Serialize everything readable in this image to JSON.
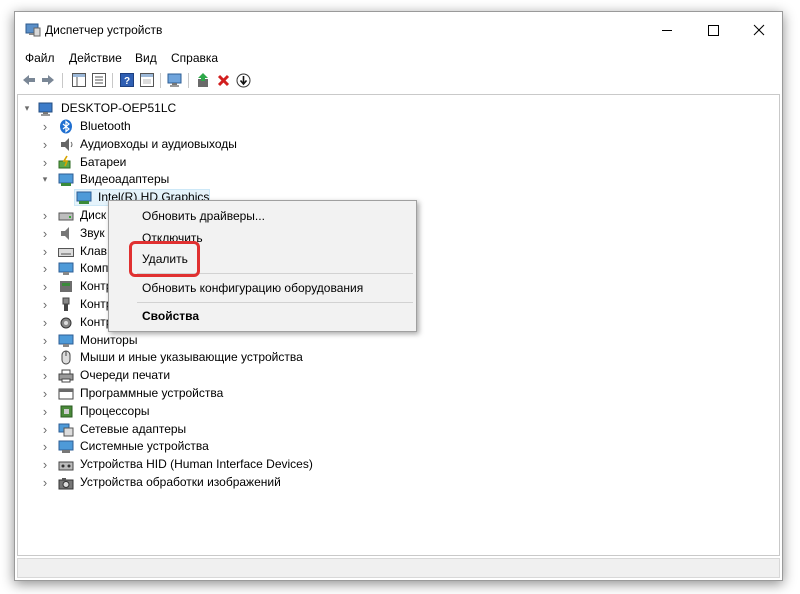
{
  "window": {
    "title": "Диспетчер устройств"
  },
  "menu": [
    "Файл",
    "Действие",
    "Вид",
    "Справка"
  ],
  "tree": {
    "root": "DESKTOP-OEP51LC",
    "items": [
      {
        "label": "Bluetooth",
        "icon": "bluetooth-icon"
      },
      {
        "label": "Аудиовходы и аудиовыходы",
        "icon": "speaker-icon"
      },
      {
        "label": "Батареи",
        "icon": "battery-icon"
      },
      {
        "label": "Видеоадаптеры",
        "icon": "display-adapter-icon",
        "expanded": true
      },
      {
        "label": "Intel(R) HD Graphics",
        "icon": "display-adapter-icon",
        "child": true,
        "selected": true
      },
      {
        "label": "Диск",
        "icon": "disk-drive-icon"
      },
      {
        "label": "Звук",
        "icon": "sound-icon"
      },
      {
        "label": "Клав",
        "icon": "keyboard-icon"
      },
      {
        "label": "Комп",
        "icon": "computer-icon"
      },
      {
        "label": "Контр",
        "icon": "controller-icon"
      },
      {
        "label": "Контр",
        "icon": "usb-icon"
      },
      {
        "label": "Контр",
        "icon": "storage-controller-icon"
      },
      {
        "label": "Мониторы",
        "icon": "monitor-icon"
      },
      {
        "label": "Мыши и иные указывающие устройства",
        "icon": "mouse-icon"
      },
      {
        "label": "Очереди печати",
        "icon": "printer-icon"
      },
      {
        "label": "Программные устройства",
        "icon": "software-device-icon"
      },
      {
        "label": "Процессоры",
        "icon": "processor-icon"
      },
      {
        "label": "Сетевые адаптеры",
        "icon": "network-adapter-icon"
      },
      {
        "label": "Системные устройства",
        "icon": "system-device-icon"
      },
      {
        "label": "Устройства HID (Human Interface Devices)",
        "icon": "hid-icon"
      },
      {
        "label": "Устройства обработки изображений",
        "icon": "camera-icon"
      }
    ]
  },
  "context_menu": {
    "update_drivers": "Обновить драйверы...",
    "disable": "Отключить",
    "uninstall": "Удалить",
    "scan": "Обновить конфигурацию оборудования",
    "properties": "Свойства"
  },
  "colors": {
    "highlight": "#e03030",
    "selection": "#e5f3fb"
  }
}
